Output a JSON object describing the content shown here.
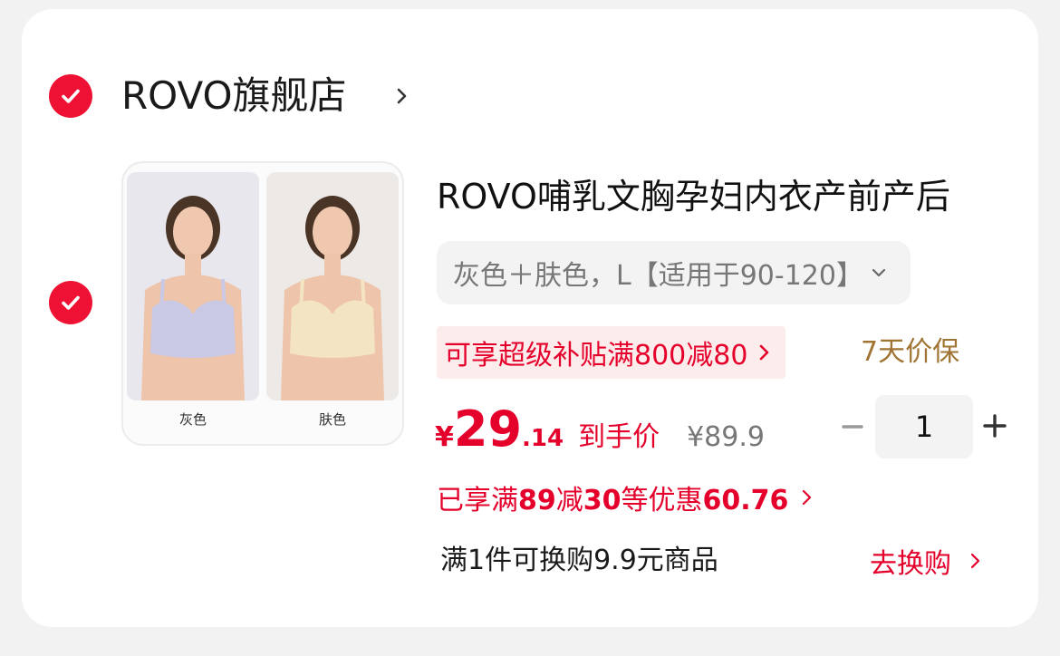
{
  "shop": {
    "name": "ROVO旗舰店",
    "checked": true
  },
  "item": {
    "checked": true,
    "title": "ROVO哺乳文胸孕妇内衣产前产后",
    "thumbnail": {
      "swatches": [
        {
          "label": "灰色",
          "color": "#c9c9e6"
        },
        {
          "label": "肤色",
          "color": "#f3e4c4"
        }
      ]
    },
    "sku": "灰色＋肤色，L【适用于90-120】",
    "subsidy": "可享超级补贴满800减80",
    "price_protect": "7天价保",
    "price": {
      "currency": "¥",
      "integer": "29",
      "decimal": ".14",
      "label": "到手价",
      "original": "¥89.9"
    },
    "quantity": "1",
    "discount": {
      "prefix": "已享满",
      "threshold": "89",
      "mid": "减",
      "amount": "30",
      "suffix": "等优惠",
      "total": "60.76"
    },
    "exchange": {
      "text": "满1件可换购9.9元商品",
      "action": "去换购"
    }
  },
  "colors": {
    "accent": "#ee1133",
    "price_red": "#e4002b",
    "gold": "#a07433"
  }
}
